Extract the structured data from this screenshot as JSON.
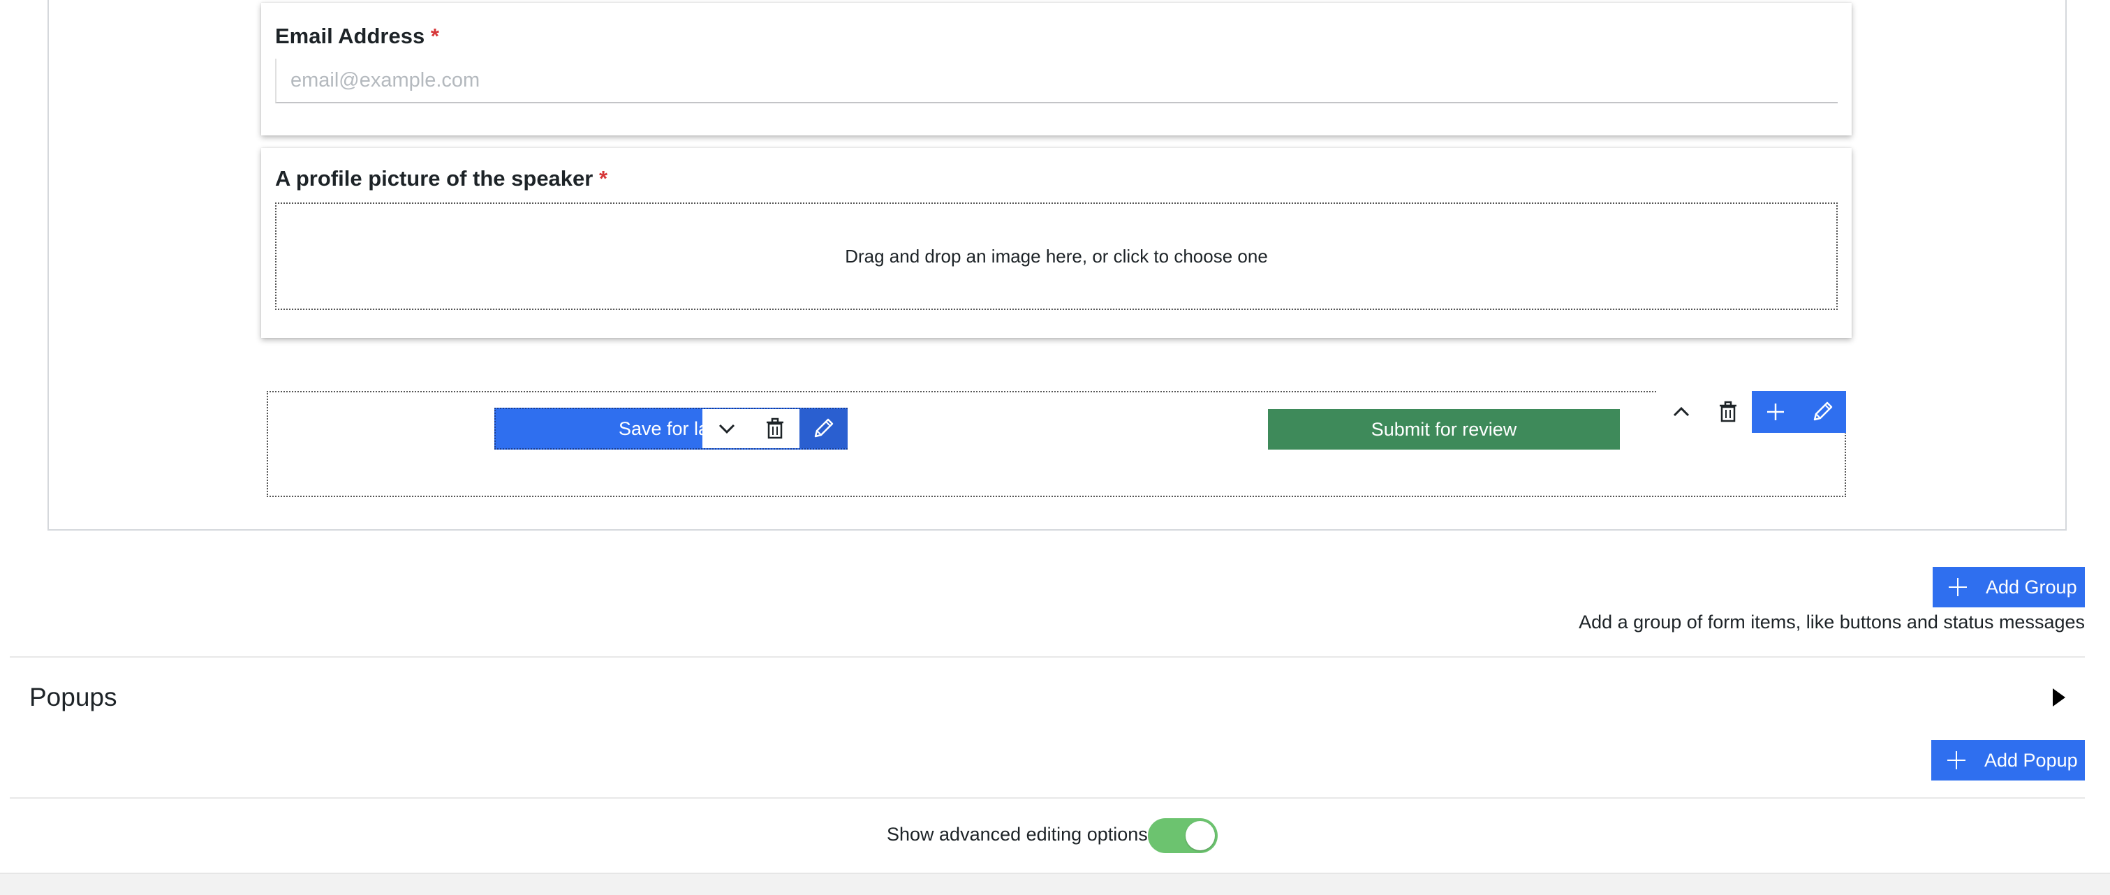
{
  "form": {
    "email_field": {
      "label": "Email Address",
      "required_mark": "*",
      "value": "",
      "placeholder": "email@example.com"
    },
    "picture_field": {
      "label": "A profile picture of the speaker",
      "required_mark": "*",
      "dropzone_text": "Drag and drop an image here, or click to choose one"
    },
    "button_group": {
      "save_label": "Save for la",
      "submit_label": "Submit for review"
    }
  },
  "groups": {
    "add_label": "Add Group",
    "hint": "Add a group of form items, like buttons and status messages"
  },
  "popups": {
    "title": "Popups",
    "add_label": "Add Popup"
  },
  "advanced": {
    "label": "Show advanced editing options",
    "enabled": true
  },
  "colors": {
    "primary": "#2f6fef",
    "submit": "#3e8a5a",
    "required": "#d63638",
    "toggle_on": "#6cc36f"
  },
  "icons": {
    "move_down": "chevron-down-icon",
    "move_up": "chevron-up-icon",
    "delete": "trash-icon",
    "edit": "pencil-icon",
    "add": "plus-icon",
    "expand": "caret-right-icon"
  }
}
